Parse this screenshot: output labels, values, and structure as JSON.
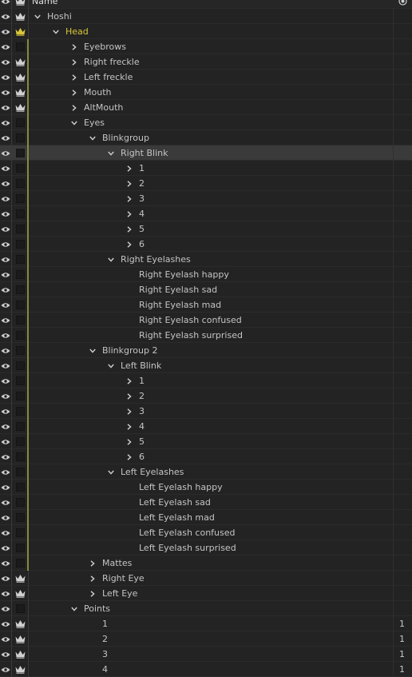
{
  "header": {
    "name_label": "Name"
  },
  "rows": [
    {
      "label": "Hoshi",
      "indent": 0,
      "expander": "down",
      "lock": "crown",
      "guide": false
    },
    {
      "label": "Head",
      "indent": 1,
      "expander": "down",
      "lock": "crown-yellow",
      "guide": false,
      "color": "yellow"
    },
    {
      "label": "Eyebrows",
      "indent": 2,
      "expander": "right",
      "lock": "square",
      "guide": true
    },
    {
      "label": "Right freckle",
      "indent": 2,
      "expander": "right",
      "lock": "crown",
      "guide": true
    },
    {
      "label": "Left freckle",
      "indent": 2,
      "expander": "right",
      "lock": "crown",
      "guide": true
    },
    {
      "label": "Mouth",
      "indent": 2,
      "expander": "right",
      "lock": "crown",
      "guide": true
    },
    {
      "label": "AltMouth",
      "indent": 2,
      "expander": "right",
      "lock": "crown",
      "guide": true
    },
    {
      "label": "Eyes",
      "indent": 2,
      "expander": "down",
      "lock": "square",
      "guide": true
    },
    {
      "label": "Blinkgroup",
      "indent": 3,
      "expander": "down",
      "lock": "square",
      "guide": true
    },
    {
      "label": "Right Blink",
      "indent": 4,
      "expander": "down",
      "lock": "square",
      "guide": true,
      "selected": true
    },
    {
      "label": "1",
      "indent": 5,
      "expander": "right",
      "lock": "square",
      "guide": true
    },
    {
      "label": "2",
      "indent": 5,
      "expander": "right",
      "lock": "square",
      "guide": true
    },
    {
      "label": "3",
      "indent": 5,
      "expander": "right",
      "lock": "square",
      "guide": true
    },
    {
      "label": "4",
      "indent": 5,
      "expander": "right",
      "lock": "square",
      "guide": true
    },
    {
      "label": "5",
      "indent": 5,
      "expander": "right",
      "lock": "square",
      "guide": true
    },
    {
      "label": "6",
      "indent": 5,
      "expander": "right",
      "lock": "square",
      "guide": true
    },
    {
      "label": "Right Eyelashes",
      "indent": 4,
      "expander": "down",
      "lock": "square",
      "guide": true
    },
    {
      "label": "Right Eyelash happy",
      "indent": 5,
      "expander": "none",
      "lock": "square",
      "guide": true
    },
    {
      "label": "Right Eyelash sad",
      "indent": 5,
      "expander": "none",
      "lock": "square",
      "guide": true
    },
    {
      "label": "Right Eyelash mad",
      "indent": 5,
      "expander": "none",
      "lock": "square",
      "guide": true
    },
    {
      "label": "Right Eyelash confused",
      "indent": 5,
      "expander": "none",
      "lock": "square",
      "guide": true
    },
    {
      "label": "Right Eyelash surprised",
      "indent": 5,
      "expander": "none",
      "lock": "square",
      "guide": true
    },
    {
      "label": "Blinkgroup 2",
      "indent": 3,
      "expander": "down",
      "lock": "square",
      "guide": true
    },
    {
      "label": "Left Blink",
      "indent": 4,
      "expander": "down",
      "lock": "square",
      "guide": true
    },
    {
      "label": "1",
      "indent": 5,
      "expander": "right",
      "lock": "square",
      "guide": true
    },
    {
      "label": "2",
      "indent": 5,
      "expander": "right",
      "lock": "square",
      "guide": true
    },
    {
      "label": "3",
      "indent": 5,
      "expander": "right",
      "lock": "square",
      "guide": true
    },
    {
      "label": "4",
      "indent": 5,
      "expander": "right",
      "lock": "square",
      "guide": true
    },
    {
      "label": "5",
      "indent": 5,
      "expander": "right",
      "lock": "square",
      "guide": true
    },
    {
      "label": "6",
      "indent": 5,
      "expander": "right",
      "lock": "square",
      "guide": true
    },
    {
      "label": "Left Eyelashes",
      "indent": 4,
      "expander": "down",
      "lock": "square",
      "guide": true
    },
    {
      "label": "Left Eyelash happy",
      "indent": 5,
      "expander": "none",
      "lock": "square",
      "guide": true
    },
    {
      "label": "Left Eyelash sad",
      "indent": 5,
      "expander": "none",
      "lock": "square",
      "guide": true
    },
    {
      "label": "Left Eyelash mad",
      "indent": 5,
      "expander": "none",
      "lock": "square",
      "guide": true
    },
    {
      "label": "Left Eyelash confused",
      "indent": 5,
      "expander": "none",
      "lock": "square",
      "guide": true
    },
    {
      "label": "Left Eyelash surprised",
      "indent": 5,
      "expander": "none",
      "lock": "square",
      "guide": true
    },
    {
      "label": "Mattes",
      "indent": 3,
      "expander": "right",
      "lock": "square",
      "guide": true
    },
    {
      "label": "Right Eye",
      "indent": 3,
      "expander": "right",
      "lock": "crown",
      "guide": false
    },
    {
      "label": "Left Eye",
      "indent": 3,
      "expander": "right",
      "lock": "crown",
      "guide": false
    },
    {
      "label": "Points",
      "indent": 2,
      "expander": "down",
      "lock": "square",
      "guide": false
    },
    {
      "label": "1",
      "indent": 3,
      "expander": "none",
      "lock": "crown",
      "guide": false,
      "value": "1"
    },
    {
      "label": "2",
      "indent": 3,
      "expander": "none",
      "lock": "crown",
      "guide": false,
      "value": "1"
    },
    {
      "label": "3",
      "indent": 3,
      "expander": "none",
      "lock": "crown",
      "guide": false,
      "value": "1"
    },
    {
      "label": "4",
      "indent": 3,
      "expander": "none",
      "lock": "crown",
      "guide": false,
      "value": "1"
    }
  ],
  "colors": {
    "accent_yellow": "#d8c73a",
    "background": "#232323"
  }
}
